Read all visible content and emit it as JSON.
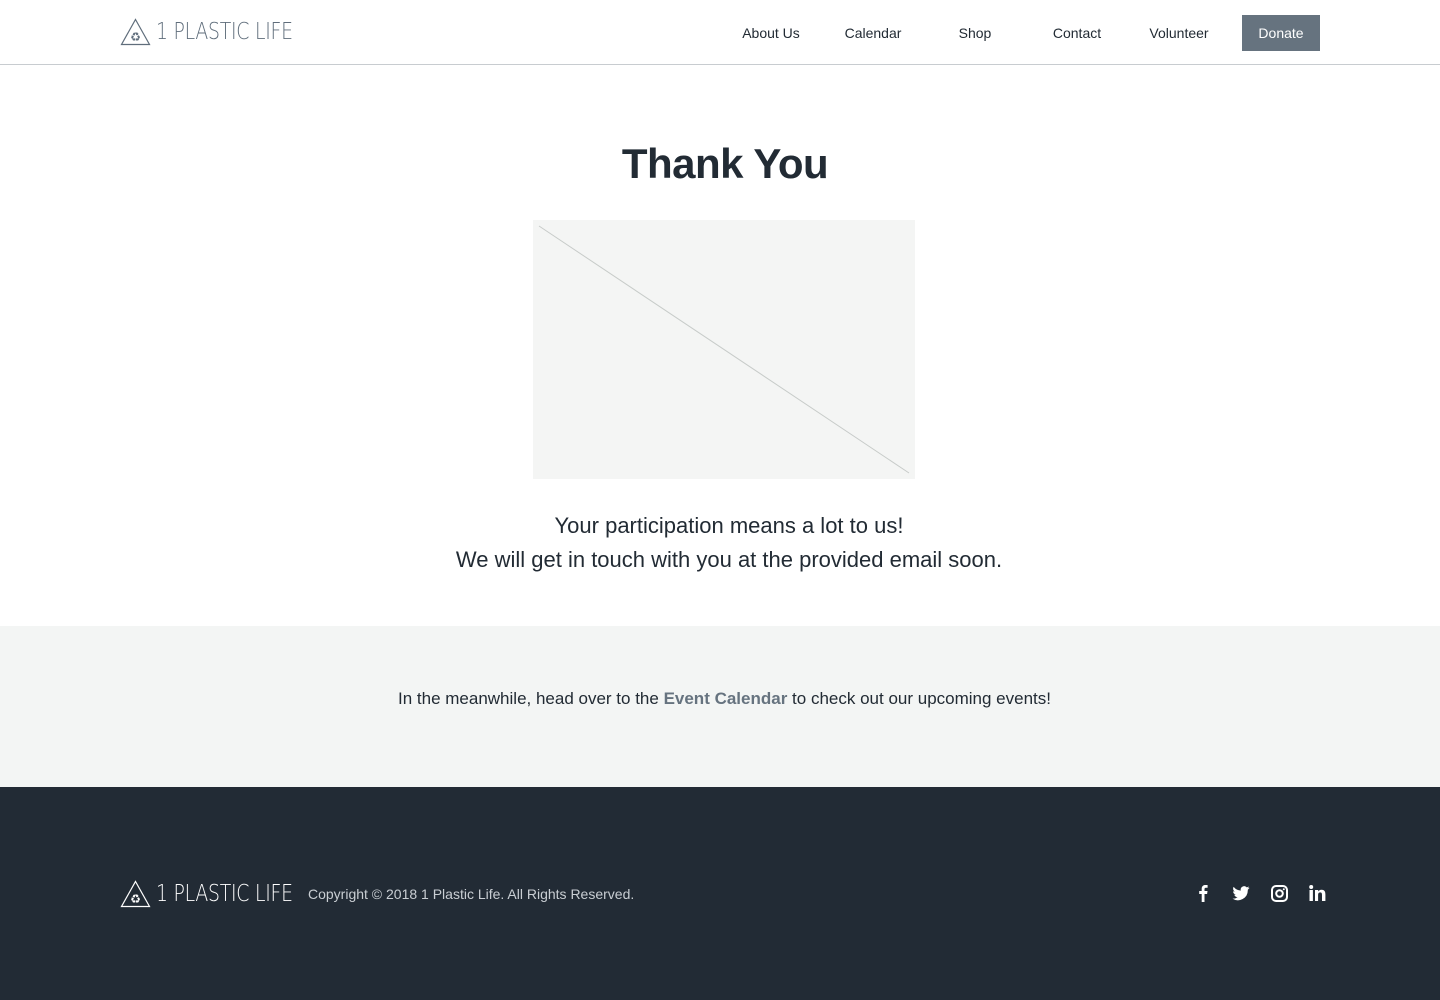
{
  "brand": {
    "name": "1 PLASTIC LIFE"
  },
  "nav": {
    "items": [
      {
        "label": "About Us"
      },
      {
        "label": "Calendar"
      },
      {
        "label": "Shop"
      },
      {
        "label": "Contact"
      },
      {
        "label": "Volunteer"
      }
    ],
    "donate_label": "Donate"
  },
  "main": {
    "title": "Thank You",
    "message_line1": "Your participation means a lot to us!",
    "message_line2": "We will get in touch with you at the provided email soon."
  },
  "callout": {
    "before": "In the meanwhile, head over to the ",
    "link_label": "Event Calendar",
    "after": " to check out our upcoming events!"
  },
  "footer": {
    "copyright": "Copyright © 2018 1 Plastic Life. All Rights Reserved.",
    "socials": [
      {
        "icon": "facebook-icon"
      },
      {
        "icon": "twitter-icon"
      },
      {
        "icon": "instagram-icon"
      },
      {
        "icon": "linkedin-icon"
      }
    ]
  },
  "colors": {
    "text_dark": "#222b34",
    "accent": "#66737f",
    "footer_bg": "#222b35",
    "band_bg": "#f3f5f4"
  }
}
